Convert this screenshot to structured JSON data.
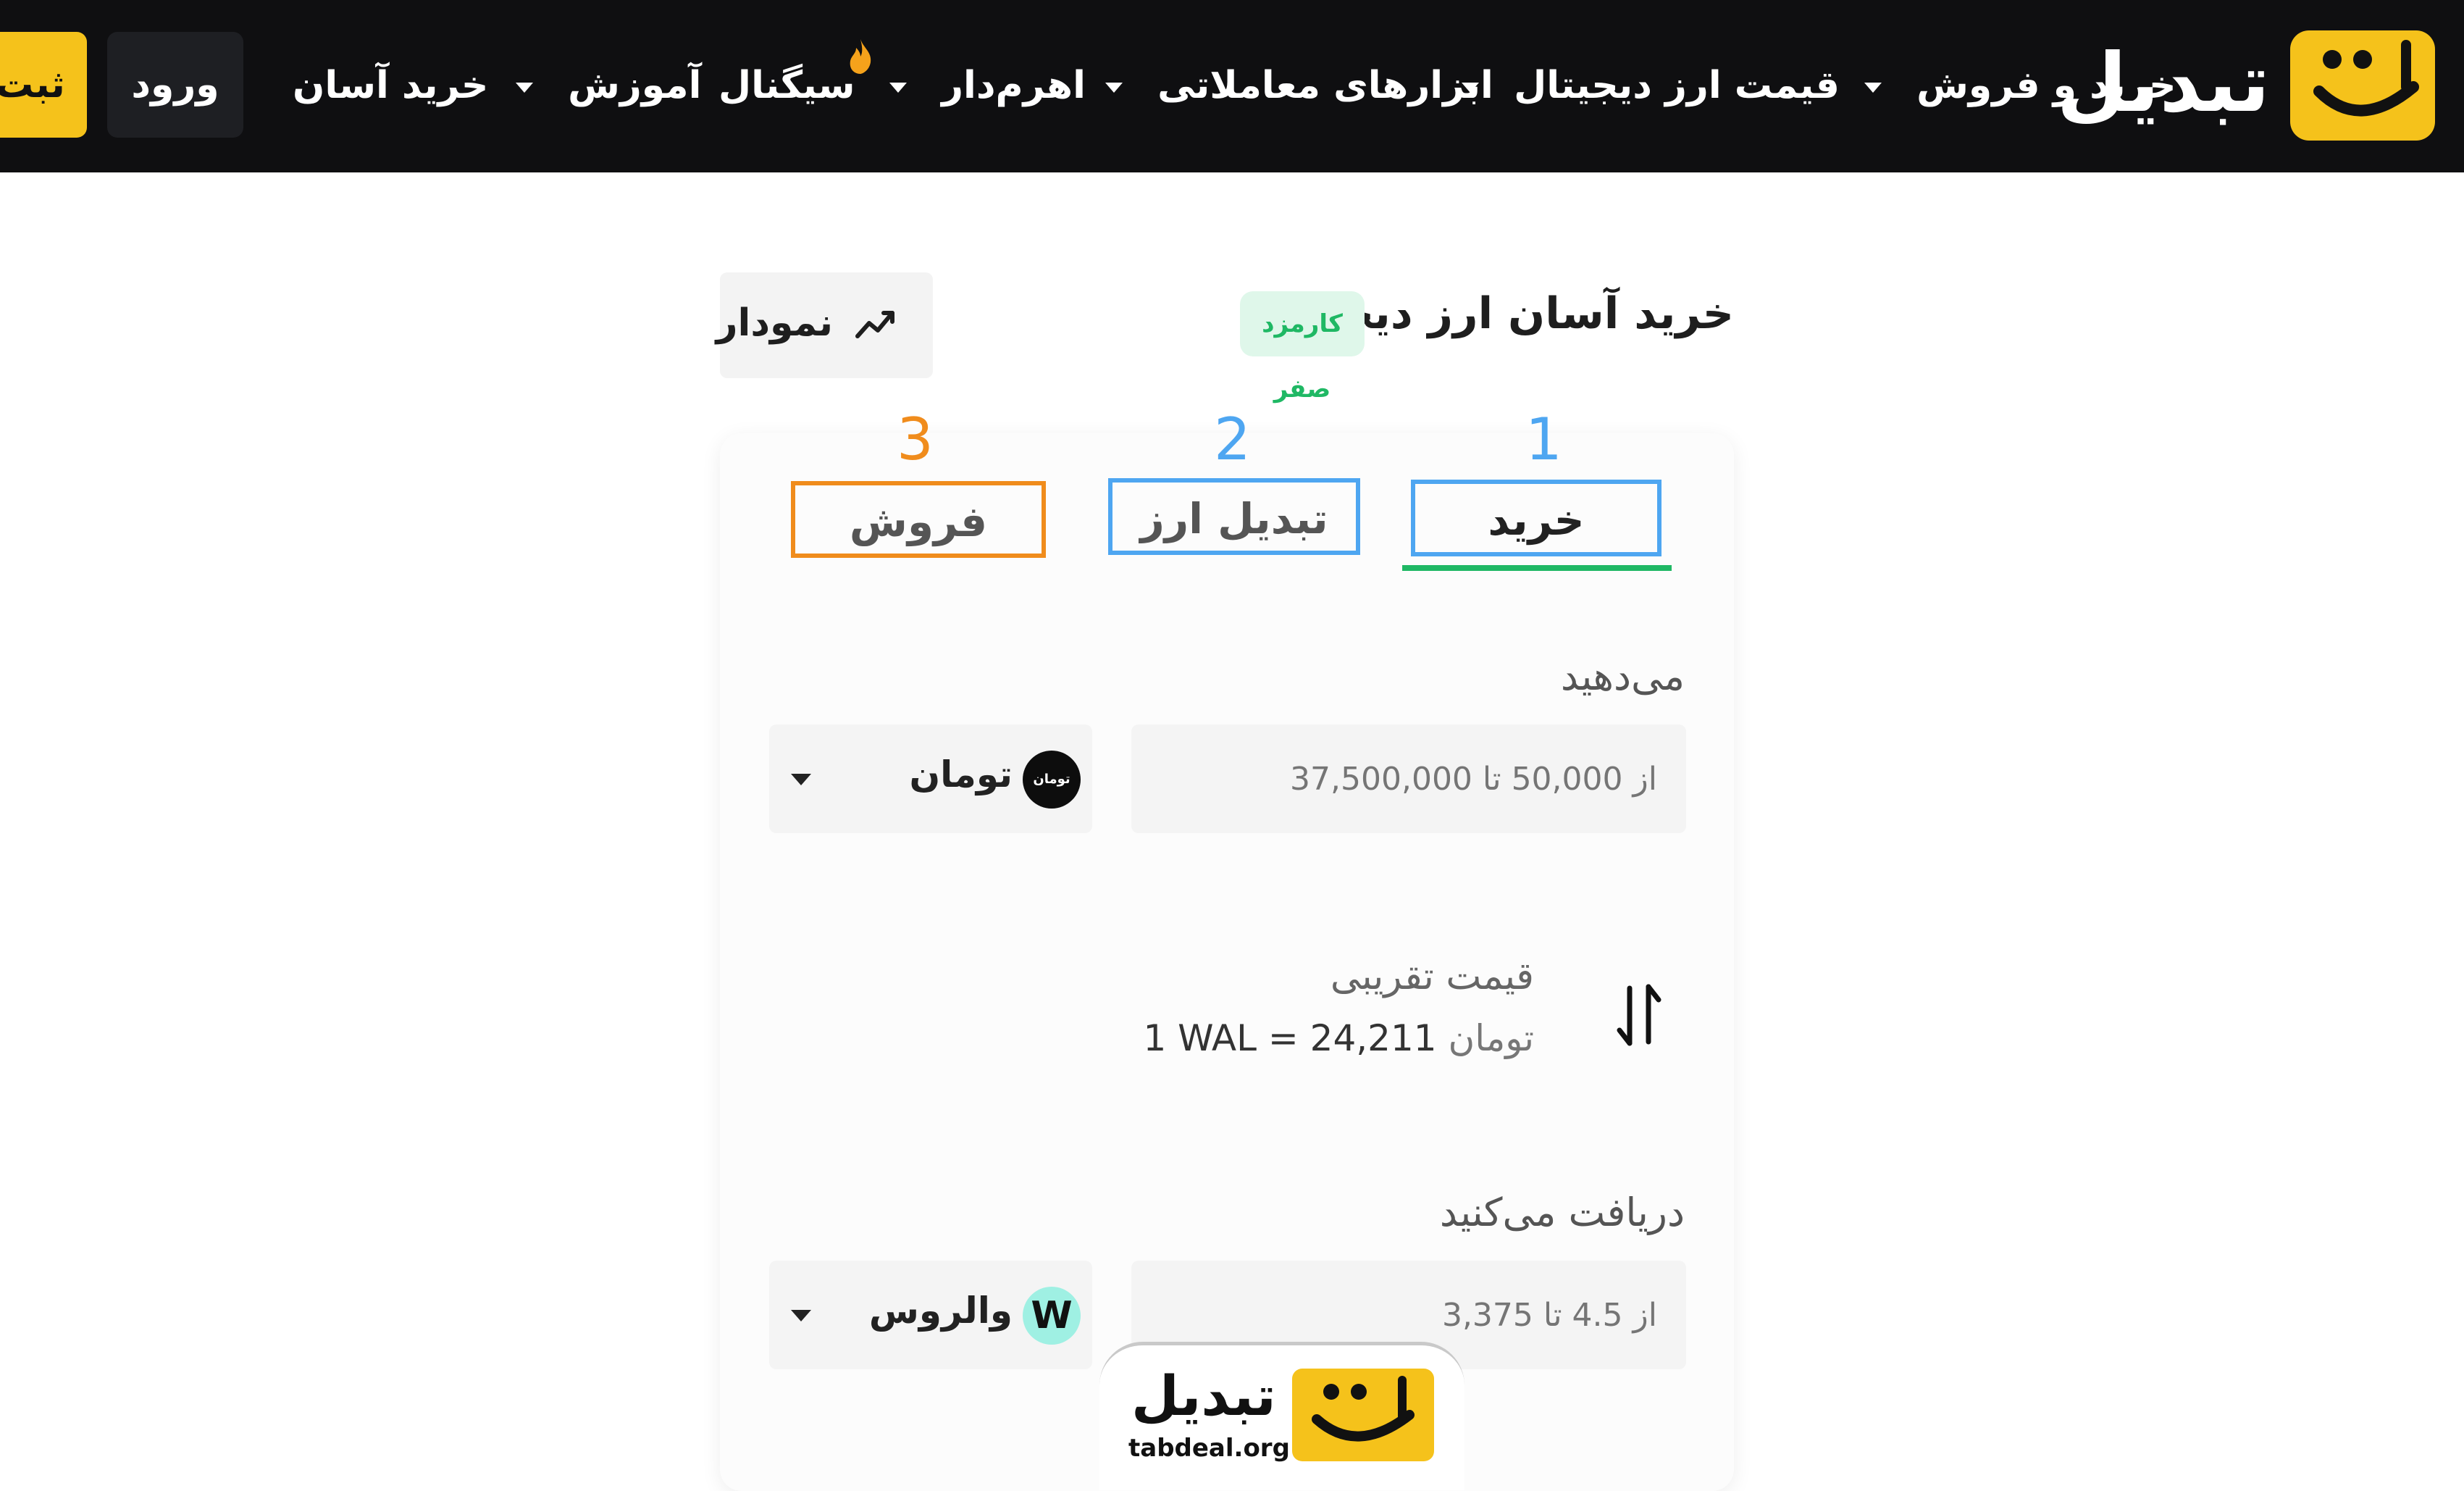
{
  "navbar": {
    "logo_text": "تبدیل",
    "items": [
      {
        "label": "خرید و فروش",
        "has_dropdown": true
      },
      {
        "label": "قیمت ارز دیجیتال",
        "has_dropdown": true
      },
      {
        "label": "ابزارهای معاملاتی",
        "has_dropdown": true
      },
      {
        "label": "اهرم‌دار",
        "has_dropdown": true,
        "badge_icon": "fire-icon"
      },
      {
        "label": "سیگنال",
        "has_dropdown": false
      },
      {
        "label": "آموزش",
        "has_dropdown": true
      },
      {
        "label": "خرید آسان",
        "has_dropdown": false
      }
    ],
    "login_label": "ورود",
    "signup_label": "ثبت",
    "accent_color": "#f5c21b"
  },
  "header": {
    "title": "خرید آسان ارز دیجیتال",
    "fee_badge": "کارمزد صفر",
    "chart_button_label": "نمودار",
    "chart_button_icon": "trend-line-icon"
  },
  "tabs": [
    {
      "label": "خرید",
      "number": "1",
      "active": true
    },
    {
      "label": "تبدیل ارز",
      "number": "2",
      "active": false
    },
    {
      "label": "فروش",
      "number": "3",
      "active": false
    }
  ],
  "give": {
    "label": "می‌دهید",
    "placeholder": "از 50,000 تا 37,500,000",
    "currency": "تومان",
    "currency_icon_text": "تومان"
  },
  "price": {
    "title": "قیمت تقریبی",
    "lhs": "1 WAL",
    "equals": "=",
    "amount": "24,211",
    "unit": "تومان"
  },
  "receive": {
    "label": "دریافت می‌کنید",
    "placeholder": "از 4.5 تا 3,375",
    "currency": "والروس",
    "currency_icon_text": "W"
  },
  "watermark": {
    "brand": "تبدیل",
    "url": "tabdeal.org"
  },
  "colors": {
    "active_tab_underline": "#1fb864",
    "highlight_blue": "#4ea6f1",
    "highlight_orange": "#f08c1c",
    "fee_badge_text": "#1fb864"
  }
}
